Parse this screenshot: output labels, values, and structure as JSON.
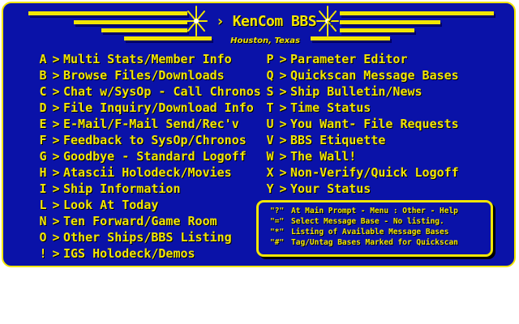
{
  "header": {
    "title": "KenCom BBS",
    "subtitle": "Houston, Texas"
  },
  "colors": {
    "background": "#0a12a8",
    "text": "#f2e600",
    "page": "#ffffff"
  },
  "menu_left": [
    {
      "key": "A",
      "label": "Multi Stats/Member Info"
    },
    {
      "key": "B",
      "label": "Browse Files/Downloads"
    },
    {
      "key": "C",
      "label": "Chat w/SysOp - Call Chronos"
    },
    {
      "key": "D",
      "label": "File Inquiry/Download Info"
    },
    {
      "key": "E",
      "label": "E-Mail/F-Mail Send/Rec'v"
    },
    {
      "key": "F",
      "label": "Feedback to SysOp/Chronos"
    },
    {
      "key": "G",
      "label": "Goodbye - Standard Logoff"
    },
    {
      "key": "H",
      "label": "Atascii Holodeck/Movies"
    },
    {
      "key": "I",
      "label": "Ship Information"
    },
    {
      "key": "L",
      "label": "Look At Today"
    },
    {
      "key": "N",
      "label": "Ten Forward/Game Room"
    },
    {
      "key": "O",
      "label": "Other Ships/BBS Listing"
    },
    {
      "key": "!",
      "label": "IGS Holodeck/Demos"
    }
  ],
  "menu_right": [
    {
      "key": "P",
      "label": "Parameter Editor"
    },
    {
      "key": "Q",
      "label": "Quickscan Message Bases"
    },
    {
      "key": "S",
      "label": "Ship Bulletin/News"
    },
    {
      "key": "T",
      "label": "Time Status"
    },
    {
      "key": "U",
      "label": "You Want- File Requests"
    },
    {
      "key": "V",
      "label": "BBS Etiquette"
    },
    {
      "key": "W",
      "label": "The Wall!"
    },
    {
      "key": "X",
      "label": "Non-Verify/Quick Logoff"
    },
    {
      "key": "Y",
      "label": "Your Status"
    }
  ],
  "menu_arrow": ">",
  "help": [
    {
      "key": "\"?\"",
      "text": "At Main Prompt - Menu : Other - Help"
    },
    {
      "key": "\"=\"",
      "text": "Select Message Base - No listing."
    },
    {
      "key": "\"*\"",
      "text": "Listing of Available Message Bases"
    },
    {
      "key": "\"#\"",
      "text": "Tag/Untag Bases Marked for Quickscan"
    }
  ],
  "icons": [
    "sparkle-star-icon-left",
    "sparkle-star-icon-right",
    "stripe-decoration"
  ]
}
